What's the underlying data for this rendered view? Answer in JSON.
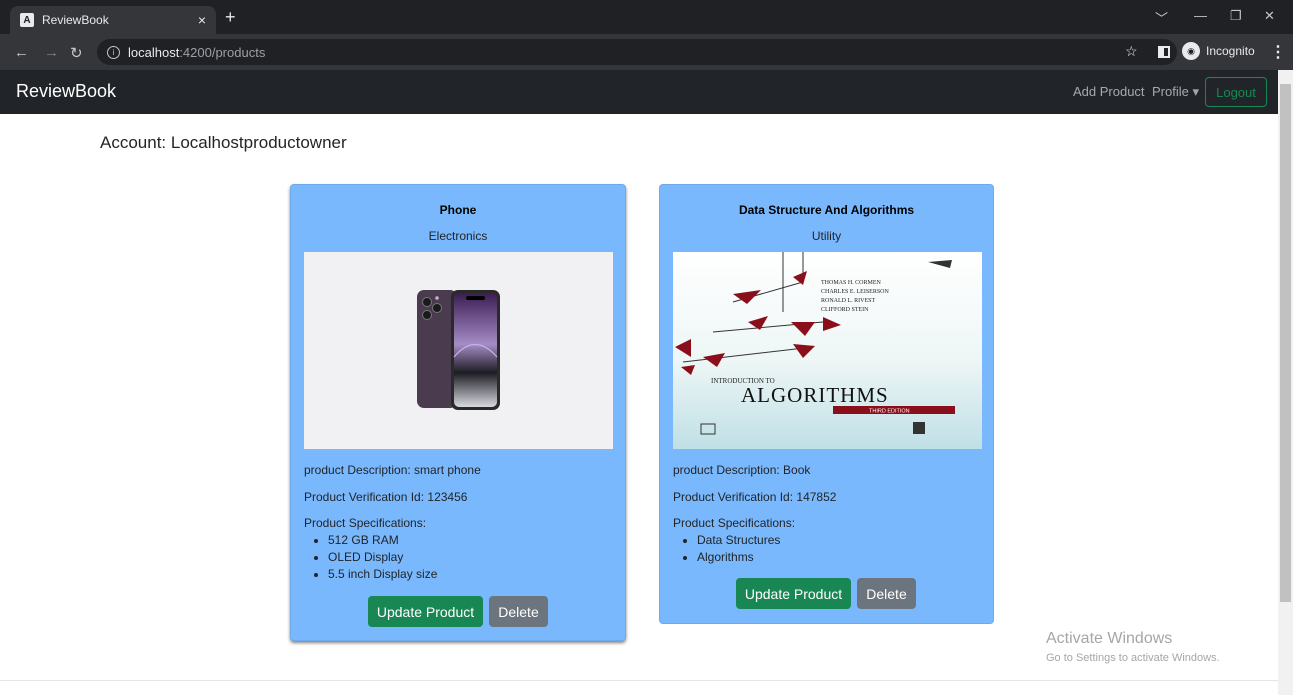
{
  "browser": {
    "tab_title": "ReviewBook",
    "tab_favicon": "A",
    "tab_close": "×",
    "new_tab": "+",
    "url_host": "localhost",
    "url_path": ":4200/products",
    "incognito_label": "Incognito"
  },
  "navbar": {
    "brand": "ReviewBook",
    "add_product": "Add Product",
    "profile": "Profile ▾",
    "logout": "Logout"
  },
  "account": "Account: Localhostproductowner",
  "products": [
    {
      "title": "Phone",
      "category": "Electronics",
      "description": "product Description: smart phone",
      "verification": "Product Verification Id: 123456",
      "specs_label": "Product Specifications:",
      "specs": [
        "512 GB RAM",
        "OLED Display",
        "5.5 inch Display size"
      ],
      "update_label": "Update Product",
      "delete_label": "Delete"
    },
    {
      "title": "Data Structure And Algorithms",
      "category": "Utility",
      "description": "product Description: Book",
      "verification": "Product Verification Id: 147852",
      "specs_label": "Product Specifications:",
      "specs": [
        "Data Structures",
        "Algorithms"
      ],
      "update_label": "Update Product",
      "delete_label": "Delete",
      "book_cover": {
        "authors": [
          "THOMAS H. CORMEN",
          "CHARLES E. LEISERSON",
          "RONALD L. RIVEST",
          "CLIFFORD STEIN"
        ],
        "intro": "INTRODUCTION TO",
        "title": "ALGORITHMS",
        "edition": "THIRD EDITION"
      }
    }
  ],
  "watermark": {
    "line1": "Activate Windows",
    "line2": "Go to Settings to activate Windows."
  },
  "colors": {
    "card_bg": "#79b8fd",
    "update_btn": "#198754",
    "delete_btn": "#6c757d",
    "navbar_bg": "#212529"
  }
}
